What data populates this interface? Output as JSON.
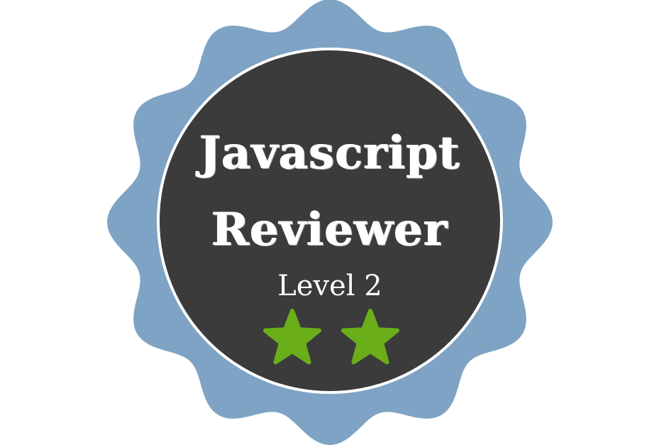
{
  "badge": {
    "title_line_1": "Javascript",
    "title_line_2": "Reviewer",
    "level_label": "Level 2",
    "stars_filled": 2,
    "icon": "star-icon",
    "colors": {
      "outer_ring": "#7ea3c4",
      "inner_disc": "#3b3b3b",
      "border": "#ffffff",
      "star": "#6aae1a",
      "text": "#ffffff"
    }
  }
}
